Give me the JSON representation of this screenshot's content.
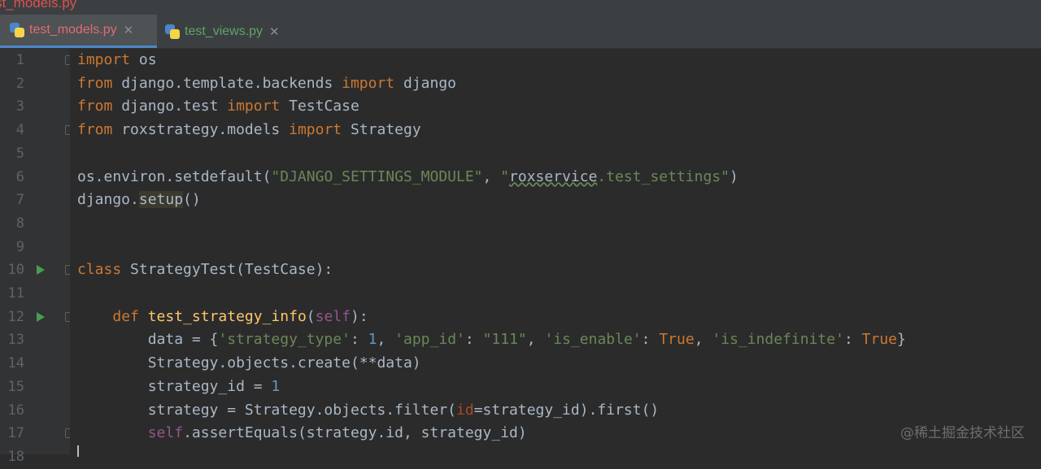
{
  "window": {
    "title_fragment": "st_models.py"
  },
  "tabs": [
    {
      "label": "test_models.py",
      "active": true,
      "color": "#e06c75"
    },
    {
      "label": "test_views.py",
      "active": false,
      "color": "#5fa36a"
    }
  ],
  "editor": {
    "line_numbers": [
      "1",
      "2",
      "3",
      "4",
      "5",
      "6",
      "7",
      "8",
      "9",
      "10",
      "11",
      "12",
      "13",
      "14",
      "15",
      "16",
      "17",
      "18"
    ],
    "lines": [
      [
        [
          "kw",
          "import"
        ],
        [
          "t",
          " os"
        ]
      ],
      [
        [
          "kw",
          "from"
        ],
        [
          "t",
          " django.template.backends "
        ],
        [
          "kw",
          "import"
        ],
        [
          "t",
          " django"
        ]
      ],
      [
        [
          "kw",
          "from"
        ],
        [
          "t",
          " django.test "
        ],
        [
          "kw",
          "import"
        ],
        [
          "t",
          " TestCase"
        ]
      ],
      [
        [
          "kw",
          "from"
        ],
        [
          "t",
          " roxstrategy.models "
        ],
        [
          "kw",
          "import"
        ],
        [
          "t",
          " Strategy"
        ]
      ],
      [],
      [
        [
          "t",
          "os.environ.setdefault("
        ],
        [
          "str",
          "\"DJANGO_SETTINGS_MODULE\""
        ],
        [
          "t",
          ", "
        ],
        [
          "str",
          "\""
        ],
        [
          "squig",
          "roxservice"
        ],
        [
          "str",
          ".test_settings\""
        ],
        [
          "t",
          ")"
        ]
      ],
      [
        [
          "t",
          "django."
        ],
        [
          "hl",
          "setup"
        ],
        [
          "t",
          "()"
        ]
      ],
      [],
      [],
      [
        [
          "kw",
          "class"
        ],
        [
          "t",
          " StrategyTest(TestCase):"
        ]
      ],
      [],
      [
        [
          "t",
          "    "
        ],
        [
          "kw",
          "def"
        ],
        [
          "t",
          " "
        ],
        [
          "fn",
          "test_strategy_info"
        ],
        [
          "t",
          "("
        ],
        [
          "self",
          "self"
        ],
        [
          "t",
          "):"
        ]
      ],
      [
        [
          "t",
          "        data = {"
        ],
        [
          "str",
          "'strategy_type'"
        ],
        [
          "t",
          ": "
        ],
        [
          "num",
          "1"
        ],
        [
          "t",
          ", "
        ],
        [
          "str",
          "'app_id'"
        ],
        [
          "t",
          ": "
        ],
        [
          "str",
          "\"111\""
        ],
        [
          "t",
          ", "
        ],
        [
          "str",
          "'is_enable'"
        ],
        [
          "t",
          ": "
        ],
        [
          "kw",
          "True"
        ],
        [
          "t",
          ", "
        ],
        [
          "str",
          "'is_indefinite'"
        ],
        [
          "t",
          ": "
        ],
        [
          "kw",
          "True"
        ],
        [
          "t",
          "}"
        ]
      ],
      [
        [
          "t",
          "        Strategy.objects.create(**data)"
        ]
      ],
      [
        [
          "t",
          "        strategy_id = "
        ],
        [
          "num",
          "1"
        ]
      ],
      [
        [
          "t",
          "        strategy = Strategy.objects.filter("
        ],
        [
          "param",
          "id"
        ],
        [
          "t",
          "=strategy_id).first()"
        ]
      ],
      [
        [
          "t",
          "        "
        ],
        [
          "self",
          "self"
        ],
        [
          "t",
          ".assertEquals(strategy.id, strategy_id)"
        ]
      ],
      []
    ],
    "run_markers": [
      10,
      12
    ],
    "fold_markers": [
      1,
      4,
      10,
      12,
      17
    ]
  },
  "watermark": "@稀土掘金技术社区",
  "colors": {
    "background": "#2b2b2b",
    "gutter": "#313335",
    "keyword": "#cc7832",
    "string": "#6a8759",
    "number": "#6897bb",
    "function": "#ffc66d",
    "self": "#94558d",
    "text": "#a9b7c6",
    "run_icon": "#499c54"
  }
}
